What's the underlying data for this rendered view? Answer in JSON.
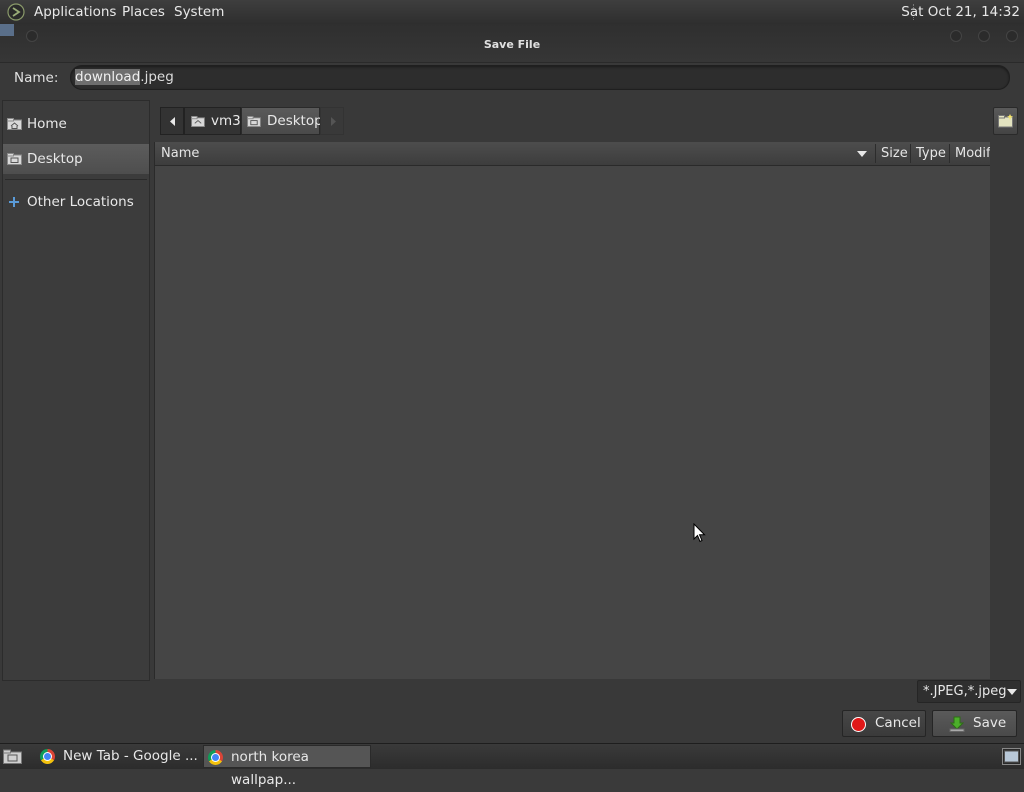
{
  "top_panel": {
    "menus": [
      "Applications",
      "Places",
      "System"
    ],
    "clock": "Sat Oct 21, 14:32"
  },
  "dialog": {
    "title": "Save File",
    "name_label": "Name:",
    "name_value_selected": "download",
    "name_value_rest": ".jpeg",
    "sidebar": {
      "items": [
        {
          "label": "Home",
          "icon": "home-folder-icon"
        },
        {
          "label": "Desktop",
          "icon": "desktop-folder-icon",
          "active": true
        },
        {
          "label": "Other Locations",
          "icon": "plus-icon"
        }
      ]
    },
    "path": [
      "vm3",
      "Desktop"
    ],
    "columns": {
      "name": "Name",
      "size": "Size",
      "type": "Type",
      "modified": "Modif"
    },
    "filter": "*.JPEG,*.jpeg",
    "cancel_label": "Cancel",
    "save_label": "Save"
  },
  "taskbar": {
    "tasks": [
      "New Tab - Google ...",
      "north korea wallpap..."
    ]
  }
}
